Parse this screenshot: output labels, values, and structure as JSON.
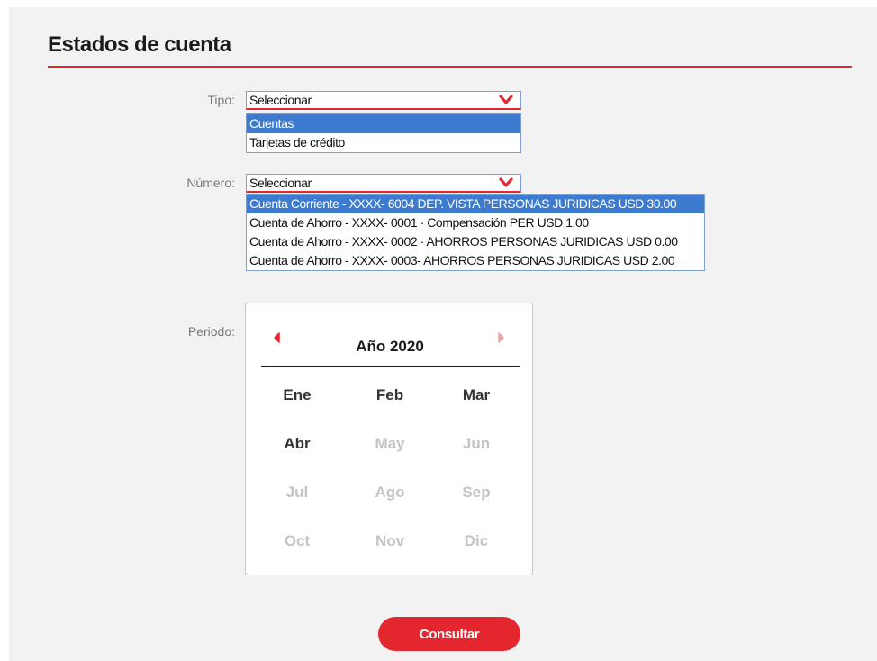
{
  "page": {
    "title": "Estados de cuenta"
  },
  "colors": {
    "accent": "#e4262e",
    "selection": "#3d7bd0",
    "background": "#f2f2f2"
  },
  "tipo": {
    "label": "Tipo:",
    "value": "Seleccionar",
    "options": [
      {
        "label": "Cuentas",
        "selected": true
      },
      {
        "label": "Tarjetas de crédito",
        "selected": false
      }
    ]
  },
  "numero": {
    "label": "Número:",
    "value": "Seleccionar",
    "options": [
      {
        "label": "Cuenta Corriente - XXXX- 6004 DEP. VISTA PERSONAS JURIDICAS USD 30.00",
        "selected": true
      },
      {
        "label": "Cuenta de Ahorro - XXXX- 0001 · Compensación PER USD 1.00",
        "selected": false
      },
      {
        "label": "Cuenta de Ahorro - XXXX- 0002 · AHORROS PERSONAS JURIDICAS USD 0.00",
        "selected": false
      },
      {
        "label": "Cuenta de Ahorro - XXXX- 0003- AHORROS PERSONAS JURIDICAS USD 2.00",
        "selected": false
      }
    ]
  },
  "periodo": {
    "label": "Periodo:",
    "year_label": "Año 2020",
    "prev_icon": "chevron-left-icon",
    "next_icon": "chevron-right-icon",
    "months": [
      {
        "label": "Ene",
        "enabled": true
      },
      {
        "label": "Feb",
        "enabled": true
      },
      {
        "label": "Mar",
        "enabled": true
      },
      {
        "label": "Abr",
        "enabled": true
      },
      {
        "label": "May",
        "enabled": false
      },
      {
        "label": "Jun",
        "enabled": false
      },
      {
        "label": "Jul",
        "enabled": false
      },
      {
        "label": "Ago",
        "enabled": false
      },
      {
        "label": "Sep",
        "enabled": false
      },
      {
        "label": "Oct",
        "enabled": false
      },
      {
        "label": "Nov",
        "enabled": false
      },
      {
        "label": "Dic",
        "enabled": false
      }
    ]
  },
  "actions": {
    "submit_label": "Consultar"
  }
}
